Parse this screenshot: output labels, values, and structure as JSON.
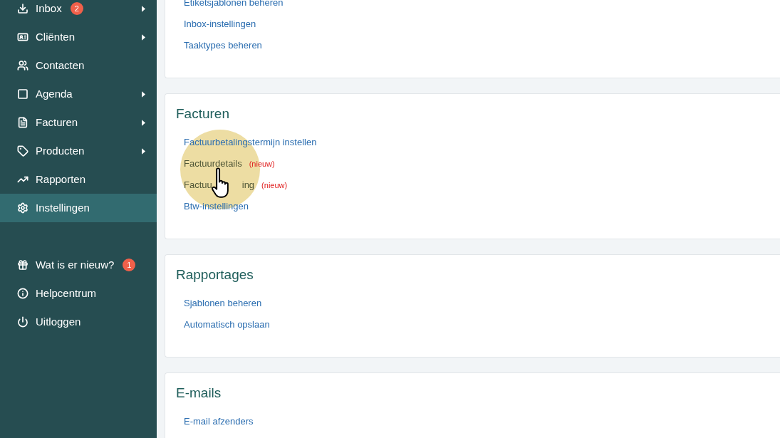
{
  "sidebar": {
    "items": [
      {
        "label": "Inbox",
        "badge": "2",
        "submenu": true,
        "selected": false
      },
      {
        "label": "Cliënten",
        "submenu": true,
        "selected": false
      },
      {
        "label": "Contacten",
        "submenu": false,
        "selected": false
      },
      {
        "label": "Agenda",
        "submenu": true,
        "selected": false
      },
      {
        "label": "Facturen",
        "submenu": true,
        "selected": false
      },
      {
        "label": "Producten",
        "submenu": true,
        "selected": false
      },
      {
        "label": "Rapporten",
        "submenu": false,
        "selected": false
      },
      {
        "label": "Instellingen",
        "submenu": false,
        "selected": true
      }
    ],
    "footer_items": [
      {
        "label": "Wat is er nieuw?",
        "badge": "1"
      },
      {
        "label": "Helpcentrum"
      },
      {
        "label": "Uitloggen"
      }
    ]
  },
  "sections": [
    {
      "links": [
        {
          "label": "Etiketsjablonen beheren"
        },
        {
          "label": "Inbox-instellingen"
        },
        {
          "label": "Taaktypes beheren"
        }
      ]
    },
    {
      "title": "Facturen",
      "cursor": true,
      "links": [
        {
          "label": "Factuurbetalingstermijn instellen"
        },
        {
          "label": "Factuurdetails",
          "tag": "(nieuw)"
        },
        {
          "label": "Factuu",
          "label_end": "ing",
          "tag": "(nieuw)"
        },
        {
          "label": "Btw-instellingen"
        }
      ]
    },
    {
      "title": "Rapportages",
      "links": [
        {
          "label": "Sjablonen beheren"
        },
        {
          "label": "Automatisch opslaan"
        }
      ]
    },
    {
      "title": "E-mails",
      "links": [
        {
          "label": "E-mail afzenders"
        }
      ]
    }
  ]
}
